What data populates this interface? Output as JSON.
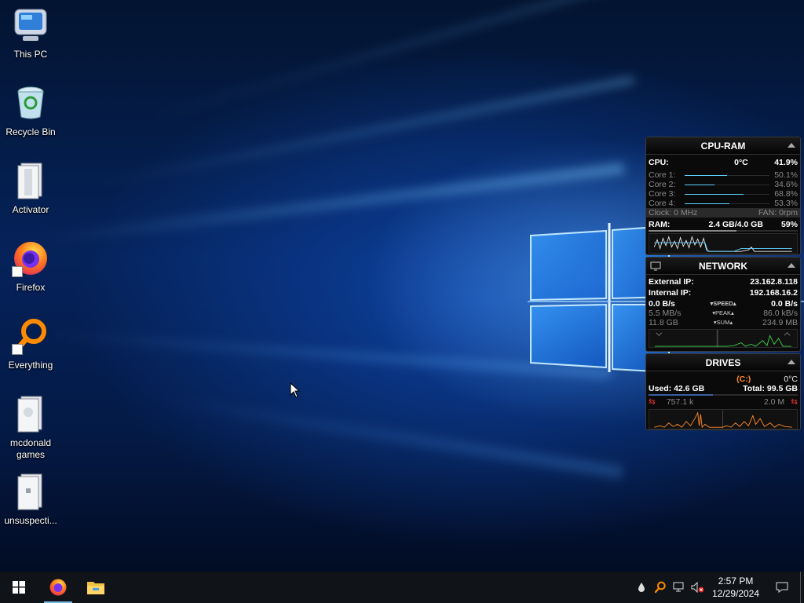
{
  "desktop": {
    "icons": [
      {
        "label": "This PC",
        "icon": "computer-icon"
      },
      {
        "label": "Recycle Bin",
        "icon": "recycle-bin-icon"
      },
      {
        "label": "Activator",
        "icon": "folder-icon"
      },
      {
        "label": "Firefox",
        "icon": "firefox-icon"
      },
      {
        "label": "Everything",
        "icon": "everything-search-icon"
      },
      {
        "label": "mcdonald games",
        "icon": "folder-icon"
      },
      {
        "label": "unsuspecti...",
        "icon": "folder-icon"
      }
    ]
  },
  "cpu_ram": {
    "title": "CPU-RAM",
    "cpu_label": "CPU:",
    "cpu_temp": "0°C",
    "cpu_pct": "41.9%",
    "cores": [
      {
        "label": "Core 1:",
        "value": "50.1%",
        "level": 0.5
      },
      {
        "label": "Core 2:",
        "value": "34.6%",
        "level": 0.35
      },
      {
        "label": "Core 3:",
        "value": "68.8%",
        "level": 0.69
      },
      {
        "label": "Core 4:",
        "value": "53.3%",
        "level": 0.53
      }
    ],
    "clock": "Clock: 0 MHz",
    "fan": "FAN: 0rpm",
    "ram_label": "RAM:",
    "ram_value": "2.4 GB/4.0 GB",
    "ram_pct": "59%"
  },
  "network": {
    "title": "NETWORK",
    "external_ip_label": "External IP:",
    "external_ip": "23.162.8.118",
    "internal_ip_label": "Internal IP:",
    "internal_ip": "192.168.16.2",
    "speed_down": "0.0 B/s",
    "speed_label": "SPEED",
    "speed_up": "0.0 B/s",
    "peak_down": "5.5 MB/s",
    "peak_label": "PEAK",
    "peak_up": "86.0 kB/s",
    "sum_down": "11.8 GB",
    "sum_label": "SUM",
    "sum_up": "234.9 MB"
  },
  "drives": {
    "title": "DRIVES",
    "drive_letter": "(C:)",
    "temp": "0°C",
    "used": "Used: 42.6 GB",
    "total": "Total: 99.5 GB",
    "read": "757.1 k",
    "write": "2.0 M"
  },
  "taskbar": {
    "time": "2:57 PM",
    "date": "12/29/2024"
  },
  "colors": {
    "accent": "#76b9ed",
    "gadget_line": "#5fd0ff",
    "drive_graph": "#ff8a2a",
    "net_graph": "#3fd04a",
    "drive_letter": "#ff8a2a"
  }
}
